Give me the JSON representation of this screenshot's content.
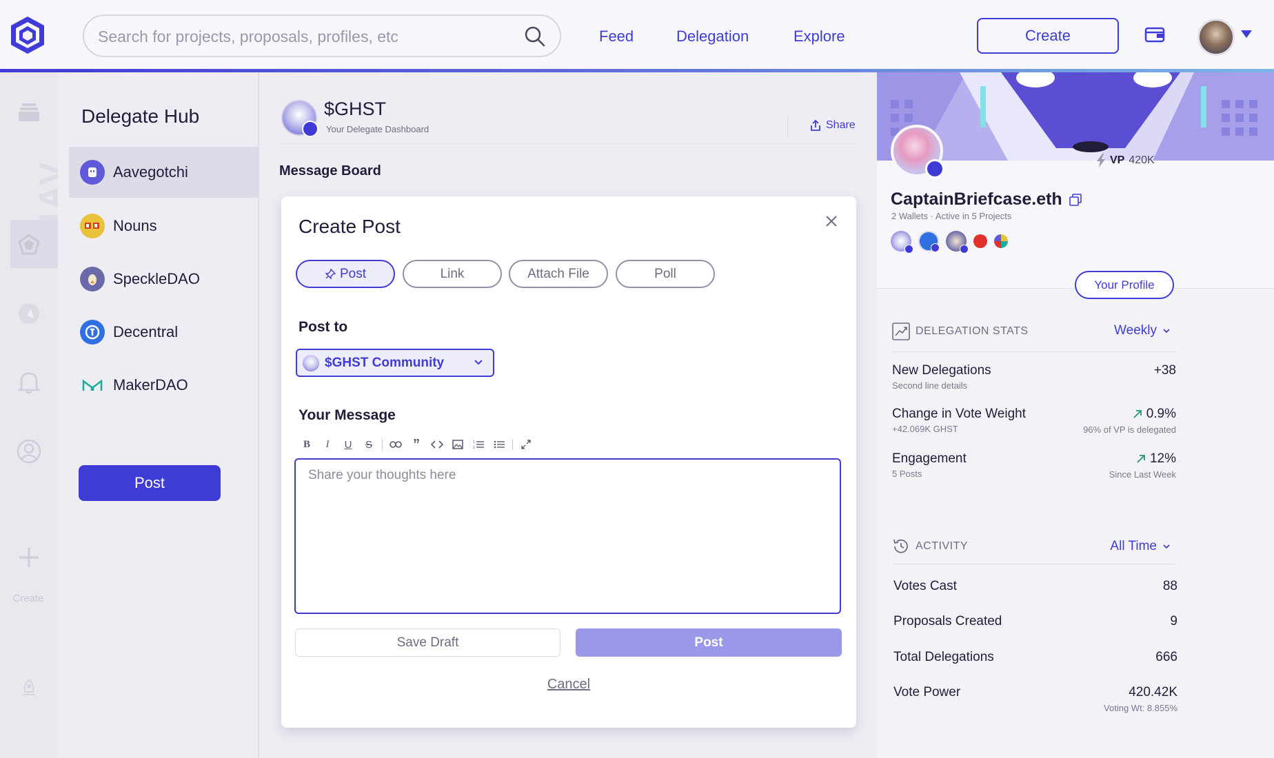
{
  "topbar": {
    "search_placeholder": "Search for projects, proposals, profiles, etc",
    "nav": [
      "Feed",
      "Delegation",
      "Explore"
    ],
    "create_label": "Create"
  },
  "rail": {
    "watermark": "NAV B",
    "create_label": "Create"
  },
  "hub": {
    "title": "Delegate Hub",
    "items": [
      {
        "label": "Aavegotchi",
        "active": true,
        "color": "#5f5ad8"
      },
      {
        "label": "Nouns",
        "active": false,
        "color": "#e8c23a"
      },
      {
        "label": "SpeckleDAO",
        "active": false,
        "color": "#6b6aa8"
      },
      {
        "label": "Decentral",
        "active": false,
        "color": "#2f6fe0"
      },
      {
        "label": "MakerDAO",
        "active": false,
        "color": "#1aab9b"
      }
    ],
    "post_label": "Post"
  },
  "main": {
    "dao_name": "$GHST",
    "dao_sub": "Your Delegate Dashboard",
    "share_label": "Share",
    "board_title": "Message Board"
  },
  "modal": {
    "title": "Create Post",
    "tabs": [
      "Post",
      "Link",
      "Attach File",
      "Poll"
    ],
    "active_tab": "Post",
    "post_to_label": "Post to",
    "post_to_value": "$GHST Community",
    "message_label": "Your Message",
    "message_placeholder": "Share your thoughts here",
    "save_draft_label": "Save Draft",
    "post_label": "Post",
    "cancel_label": "Cancel"
  },
  "profile": {
    "vp_label": "VP",
    "vp_value": "420K",
    "name": "CaptainBriefcase.eth",
    "meta": "2 Wallets · Active in 5 Projects",
    "your_profile_label": "Your Profile",
    "dao_badges": [
      "aavegotchi",
      "decentral",
      "speckledao",
      "optimism",
      "gitcoin"
    ]
  },
  "delegation_stats": {
    "title": "DELEGATION STATS",
    "period": "Weekly",
    "rows": [
      {
        "name": "New Delegations",
        "sub": "Second line details",
        "value": "+38",
        "rsub": "",
        "trend": false
      },
      {
        "name": "Change in Vote Weight",
        "sub": "+42.069K GHST",
        "value": "0.9%",
        "rsub": "96% of VP is delegated",
        "trend": true
      },
      {
        "name": "Engagement",
        "sub": "5 Posts",
        "value": "12%",
        "rsub": "Since Last Week",
        "trend": true
      }
    ]
  },
  "activity": {
    "title": "ACTIVITY",
    "period": "All Time",
    "rows": [
      {
        "name": "Votes Cast",
        "value": "88",
        "sub": ""
      },
      {
        "name": "Proposals Created",
        "value": "9",
        "sub": ""
      },
      {
        "name": "Total Delegations",
        "value": "666",
        "sub": ""
      },
      {
        "name": "Vote Power",
        "value": "420.42K",
        "sub": "Voting Wt: 8.855%"
      }
    ]
  },
  "colors": {
    "accent": "#3f3bd6",
    "accent_light": "#9b98ea",
    "trend_up": "#1a9a6c"
  }
}
